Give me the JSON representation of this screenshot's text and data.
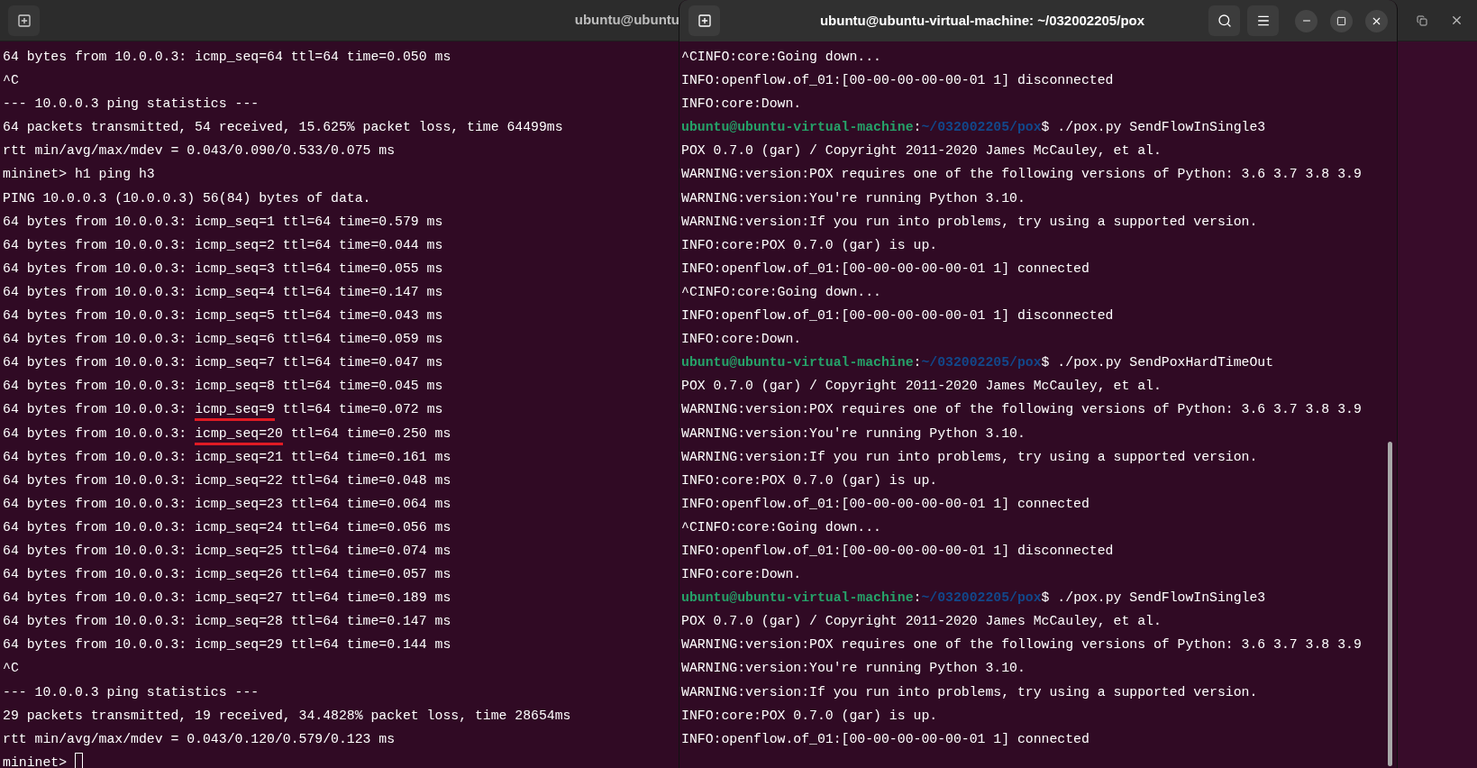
{
  "back_window": {
    "title": "ubuntu@ubuntu",
    "lines": [
      {
        "text": "64 bytes from 10.0.0.3: icmp_seq=64 ttl=64 time=0.050 ms"
      },
      {
        "text": "^C"
      },
      {
        "text": "--- 10.0.0.3 ping statistics ---"
      },
      {
        "text": "64 packets transmitted, 54 received, 15.625% packet loss, time 64499ms"
      },
      {
        "text": "rtt min/avg/max/mdev = 0.043/0.090/0.533/0.075 ms"
      },
      {
        "text": "mininet> h1 ping h3"
      },
      {
        "text": "PING 10.0.0.3 (10.0.0.3) 56(84) bytes of data."
      },
      {
        "text": "64 bytes from 10.0.0.3: icmp_seq=1 ttl=64 time=0.579 ms"
      },
      {
        "text": "64 bytes from 10.0.0.3: icmp_seq=2 ttl=64 time=0.044 ms"
      },
      {
        "text": "64 bytes from 10.0.0.3: icmp_seq=3 ttl=64 time=0.055 ms"
      },
      {
        "text": "64 bytes from 10.0.0.3: icmp_seq=4 ttl=64 time=0.147 ms"
      },
      {
        "text": "64 bytes from 10.0.0.3: icmp_seq=5 ttl=64 time=0.043 ms"
      },
      {
        "text": "64 bytes from 10.0.0.3: icmp_seq=6 ttl=64 time=0.059 ms"
      },
      {
        "text": "64 bytes from 10.0.0.3: icmp_seq=7 ttl=64 time=0.047 ms"
      },
      {
        "text": "64 bytes from 10.0.0.3: icmp_seq=8 ttl=64 time=0.045 ms"
      },
      {
        "segments": [
          {
            "text": "64 bytes from 10.0.0.3: ",
            "underlined": false
          },
          {
            "text": "icmp_seq=9",
            "underlined": true
          },
          {
            "text": " ttl=64 time=0.072 ms",
            "underlined": false
          }
        ]
      },
      {
        "segments": [
          {
            "text": "64 bytes from 10.0.0.3: ",
            "underlined": false
          },
          {
            "text": "icmp_seq=20",
            "underlined": true
          },
          {
            "text": " ttl=64 time=0.250 ms",
            "underlined": false
          }
        ]
      },
      {
        "text": "64 bytes from 10.0.0.3: icmp_seq=21 ttl=64 time=0.161 ms"
      },
      {
        "text": "64 bytes from 10.0.0.3: icmp_seq=22 ttl=64 time=0.048 ms"
      },
      {
        "text": "64 bytes from 10.0.0.3: icmp_seq=23 ttl=64 time=0.064 ms"
      },
      {
        "text": "64 bytes from 10.0.0.3: icmp_seq=24 ttl=64 time=0.056 ms"
      },
      {
        "text": "64 bytes from 10.0.0.3: icmp_seq=25 ttl=64 time=0.074 ms"
      },
      {
        "text": "64 bytes from 10.0.0.3: icmp_seq=26 ttl=64 time=0.057 ms"
      },
      {
        "text": "64 bytes from 10.0.0.3: icmp_seq=27 ttl=64 time=0.189 ms"
      },
      {
        "text": "64 bytes from 10.0.0.3: icmp_seq=28 ttl=64 time=0.147 ms"
      },
      {
        "text": "64 bytes from 10.0.0.3: icmp_seq=29 ttl=64 time=0.144 ms"
      },
      {
        "text": "^C"
      },
      {
        "text": "--- 10.0.0.3 ping statistics ---"
      },
      {
        "text": "29 packets transmitted, 19 received, 34.4828% packet loss, time 28654ms"
      },
      {
        "text": "rtt min/avg/max/mdev = 0.043/0.120/0.579/0.123 ms"
      },
      {
        "text": "mininet>",
        "cursor": true
      }
    ]
  },
  "front_window": {
    "title": "ubuntu@ubuntu-virtual-machine: ~/032002205/pox",
    "lines": [
      {
        "text": "^CINFO:core:Going down..."
      },
      {
        "text": "INFO:openflow.of_01:[00-00-00-00-00-01 1] disconnected"
      },
      {
        "text": "INFO:core:Down."
      },
      {
        "host": "ubuntu@ubuntu-virtual-machine",
        "sep": ":",
        "path": "~/032002205/pox",
        "command": "$ ./pox.py SendFlowInSingle3"
      },
      {
        "text": "POX 0.7.0 (gar) / Copyright 2011-2020 James McCauley, et al."
      },
      {
        "text": "WARNING:version:POX requires one of the following versions of Python: 3.6 3.7 3.8 3.9"
      },
      {
        "text": "WARNING:version:You're running Python 3.10."
      },
      {
        "text": "WARNING:version:If you run into problems, try using a supported version."
      },
      {
        "text": "INFO:core:POX 0.7.0 (gar) is up."
      },
      {
        "text": "INFO:openflow.of_01:[00-00-00-00-00-01 1] connected"
      },
      {
        "text": "^CINFO:core:Going down..."
      },
      {
        "text": "INFO:openflow.of_01:[00-00-00-00-00-01 1] disconnected"
      },
      {
        "text": "INFO:core:Down."
      },
      {
        "host": "ubuntu@ubuntu-virtual-machine",
        "sep": ":",
        "path": "~/032002205/pox",
        "command": "$ ./pox.py SendPoxHardTimeOut"
      },
      {
        "text": "POX 0.7.0 (gar) / Copyright 2011-2020 James McCauley, et al."
      },
      {
        "text": "WARNING:version:POX requires one of the following versions of Python: 3.6 3.7 3.8 3.9"
      },
      {
        "text": "WARNING:version:You're running Python 3.10."
      },
      {
        "text": "WARNING:version:If you run into problems, try using a supported version."
      },
      {
        "text": "INFO:core:POX 0.7.0 (gar) is up."
      },
      {
        "text": "INFO:openflow.of_01:[00-00-00-00-00-01 1] connected"
      },
      {
        "text": "^CINFO:core:Going down..."
      },
      {
        "text": "INFO:openflow.of_01:[00-00-00-00-00-01 1] disconnected"
      },
      {
        "text": "INFO:core:Down."
      },
      {
        "host": "ubuntu@ubuntu-virtual-machine",
        "sep": ":",
        "path": "~/032002205/pox",
        "command": "$ ./pox.py SendFlowInSingle3"
      },
      {
        "text": "POX 0.7.0 (gar) / Copyright 2011-2020 James McCauley, et al."
      },
      {
        "text": "WARNING:version:POX requires one of the following versions of Python: 3.6 3.7 3.8 3.9"
      },
      {
        "text": "WARNING:version:You're running Python 3.10."
      },
      {
        "text": "WARNING:version:If you run into problems, try using a supported version."
      },
      {
        "text": "INFO:core:POX 0.7.0 (gar) is up."
      },
      {
        "text": "INFO:openflow.of_01:[00-00-00-00-00-01 1] connected"
      }
    ]
  }
}
